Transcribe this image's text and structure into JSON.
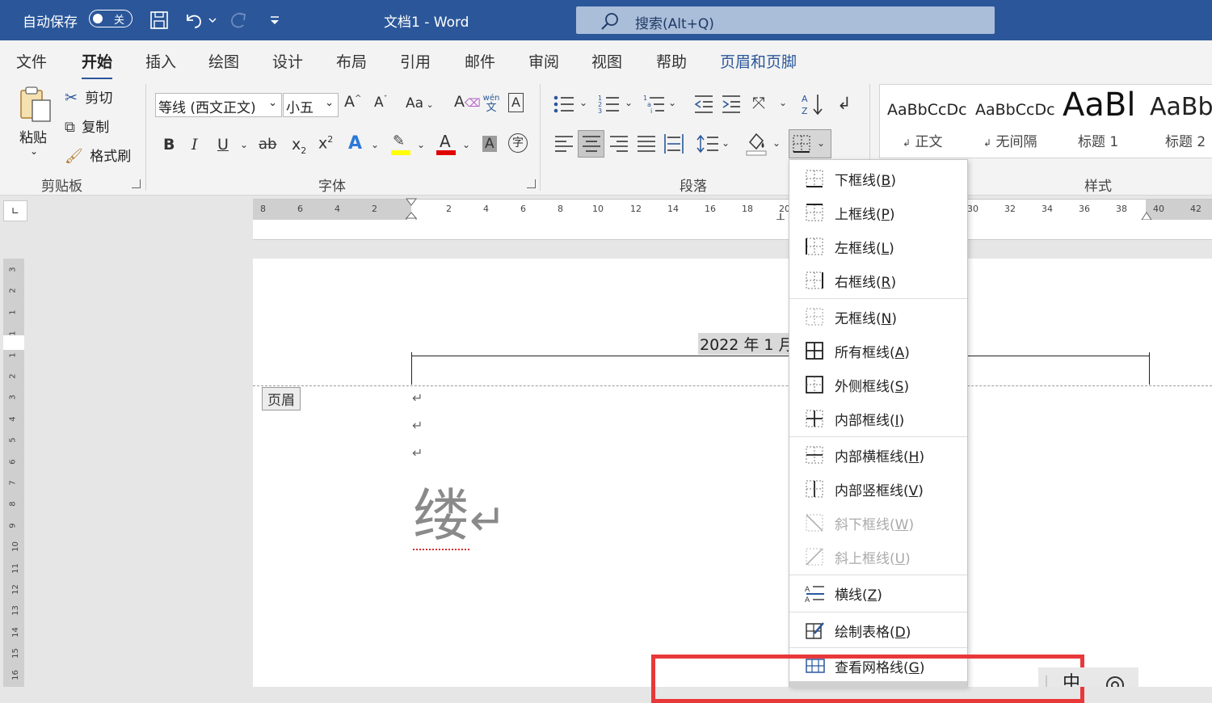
{
  "titlebar": {
    "autosave_label": "自动保存",
    "autosave_state": "关",
    "doc_title": "文档1  -  Word",
    "search_text": "搜索(Alt+Q)"
  },
  "tabs": [
    "文件",
    "开始",
    "插入",
    "绘图",
    "设计",
    "布局",
    "引用",
    "邮件",
    "审阅",
    "视图",
    "帮助",
    "页眉和页脚"
  ],
  "active_tab": "开始",
  "clipboard": {
    "paste": "粘贴",
    "cut": "剪切",
    "copy": "复制",
    "format_painter": "格式刷",
    "group": "剪贴板"
  },
  "font": {
    "name": "等线 (西文正文)",
    "size": "小五",
    "group": "字体",
    "change_case": "Aa",
    "phonetic_top": "wén",
    "phonetic_bottom": "文"
  },
  "paragraph": {
    "group": "段落"
  },
  "styles": {
    "group": "样式",
    "items": [
      {
        "preview": "AaBbCcDc",
        "name": "正文"
      },
      {
        "preview": "AaBbCcDc",
        "name": "无间隔"
      },
      {
        "preview": "AaBl",
        "name": "标题 1"
      },
      {
        "preview": "AaBb",
        "name": "标题 2"
      }
    ]
  },
  "ruler": {
    "left_numbers": [
      "8",
      "6",
      "4",
      "2"
    ],
    "right_numbers": [
      "2",
      "4",
      "6",
      "8",
      "10",
      "12",
      "14",
      "16",
      "18",
      "20"
    ],
    "far_numbers": [
      "30",
      "32",
      "34",
      "36",
      "38",
      "40",
      "42"
    ],
    "vertical_numbers": [
      "3",
      "2",
      "1",
      "1",
      "1",
      "2",
      "3",
      "4",
      "5",
      "6",
      "7",
      "8",
      "9",
      "10",
      "11",
      "12",
      "13",
      "14",
      "15",
      "16"
    ]
  },
  "document": {
    "header_date": "2022 年 1 月",
    "header_tag": "页眉",
    "para_mark": "↵",
    "big_char": "缕",
    "big_mark": "↵"
  },
  "border_menu": {
    "items": [
      {
        "label": "下框线(B)",
        "icon": "bottom-border-icon",
        "enabled": true
      },
      {
        "label": "上框线(P)",
        "icon": "top-border-icon",
        "enabled": true
      },
      {
        "label": "左框线(L)",
        "icon": "left-border-icon",
        "enabled": true
      },
      {
        "label": "右框线(R)",
        "icon": "right-border-icon",
        "enabled": true
      },
      {
        "label": "无框线(N)",
        "icon": "no-border-icon",
        "enabled": true
      },
      {
        "label": "所有框线(A)",
        "icon": "all-borders-icon",
        "enabled": true
      },
      {
        "label": "外侧框线(S)",
        "icon": "outside-borders-icon",
        "enabled": true
      },
      {
        "label": "内部框线(I)",
        "icon": "inside-borders-icon",
        "enabled": true
      },
      {
        "label": "内部横框线(H)",
        "icon": "inside-horizontal-border-icon",
        "enabled": true
      },
      {
        "label": "内部竖框线(V)",
        "icon": "inside-vertical-border-icon",
        "enabled": true
      },
      {
        "label": "斜下框线(W)",
        "icon": "diagonal-down-border-icon",
        "enabled": false
      },
      {
        "label": "斜上框线(U)",
        "icon": "diagonal-up-border-icon",
        "enabled": false
      },
      {
        "label": "横线(Z)",
        "icon": "horizontal-line-icon",
        "enabled": true
      },
      {
        "label": "绘制表格(D)",
        "icon": "draw-table-icon",
        "enabled": true
      },
      {
        "label": "查看网格线(G)",
        "icon": "view-gridlines-icon",
        "enabled": true
      }
    ]
  },
  "colors": {
    "title_bar": "#2b579a",
    "highlight": "#ffff00",
    "font_color": "#e00000",
    "annotation": "#e8383a"
  }
}
